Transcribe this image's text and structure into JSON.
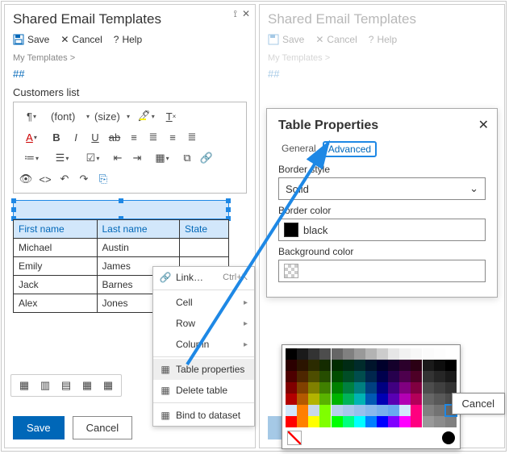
{
  "header": {
    "title": "Shared Email Templates"
  },
  "toolbar": {
    "save_label": "Save",
    "cancel_label": "Cancel",
    "help_label": "Help"
  },
  "breadcrumb": "My Templates >",
  "hashes": "##",
  "doc_title": "Customers list",
  "font_dropdown": "(font)",
  "size_dropdown": "(size)",
  "table": {
    "headers": [
      "First name",
      "Last name",
      "State"
    ],
    "rows": [
      [
        "Michael",
        "Austin",
        ""
      ],
      [
        "Emily",
        "James",
        ""
      ],
      [
        "Jack",
        "Barnes",
        ""
      ],
      [
        "Alex",
        "Jones",
        ""
      ]
    ]
  },
  "context_menu": {
    "link": "Link…",
    "link_kbd": "Ctrl+K",
    "cell": "Cell",
    "row": "Row",
    "column": "Column",
    "table_properties": "Table properties",
    "delete_table": "Delete table",
    "bind_dataset": "Bind to dataset"
  },
  "bottom": {
    "save": "Save",
    "cancel": "Cancel"
  },
  "dialog": {
    "title": "Table Properties",
    "tab_general": "General",
    "tab_advanced": "Advanced",
    "border_style_label": "Border style",
    "border_style_value": "Solid",
    "border_color_label": "Border color",
    "border_color_value": "black",
    "background_color_label": "Background color",
    "cancel": "Cancel"
  },
  "picker_colors_rows": [
    [
      "#000000",
      "#1a1a1a",
      "#333333",
      "#4d4d4d",
      "#666666",
      "#808080",
      "#999999",
      "#b3b3b3",
      "#cccccc",
      "#e6e6e6",
      "#f2f2f2",
      "#f7f7f7",
      "#fbfbfb",
      "#fdfdfd",
      "#ffffff"
    ],
    [
      "#2b0000",
      "#2b1400",
      "#2b2b00",
      "#142b00",
      "#002b00",
      "#002b14",
      "#002b2b",
      "#00142b",
      "#00002b",
      "#14002b",
      "#2b002b",
      "#2b0014",
      "#1a1a1a",
      "#0d0d0d",
      "#000000"
    ],
    [
      "#4d0000",
      "#4d2600",
      "#4d4d00",
      "#264d00",
      "#004d00",
      "#004d26",
      "#004d4d",
      "#00264d",
      "#00004d",
      "#26004d",
      "#4d004d",
      "#4d0026",
      "#333333",
      "#262626",
      "#1a1a1a"
    ],
    [
      "#800000",
      "#804000",
      "#808000",
      "#408000",
      "#008000",
      "#008040",
      "#008080",
      "#004080",
      "#000080",
      "#400080",
      "#800080",
      "#800040",
      "#4d4d4d",
      "#404040",
      "#333333"
    ],
    [
      "#b30000",
      "#b35900",
      "#b3b300",
      "#59b300",
      "#00b300",
      "#00b359",
      "#00b3b3",
      "#0059b3",
      "#0000b3",
      "#5900b3",
      "#b300b3",
      "#b30059",
      "#666666",
      "#595959",
      "#4d4d4d"
    ],
    [
      "#d2e7fb",
      "#ff7f00",
      "#c8d8e8",
      "#7fff00",
      "#b8d0ec",
      "#a8c8ec",
      "#98c0ec",
      "#88b8ec",
      "#78b0ec",
      "#68a8f0",
      "#d2e7fb",
      "#ff007f",
      "#808080",
      "#737373",
      "#666666"
    ],
    [
      "#ff0000",
      "#ff8000",
      "#ffff00",
      "#80ff00",
      "#00ff00",
      "#00ff80",
      "#00ffff",
      "#0080ff",
      "#0000ff",
      "#8000ff",
      "#ff00ff",
      "#ff0080",
      "#999999",
      "#8c8c8c",
      "#808080"
    ]
  ],
  "picker_selected": [
    5,
    14
  ]
}
